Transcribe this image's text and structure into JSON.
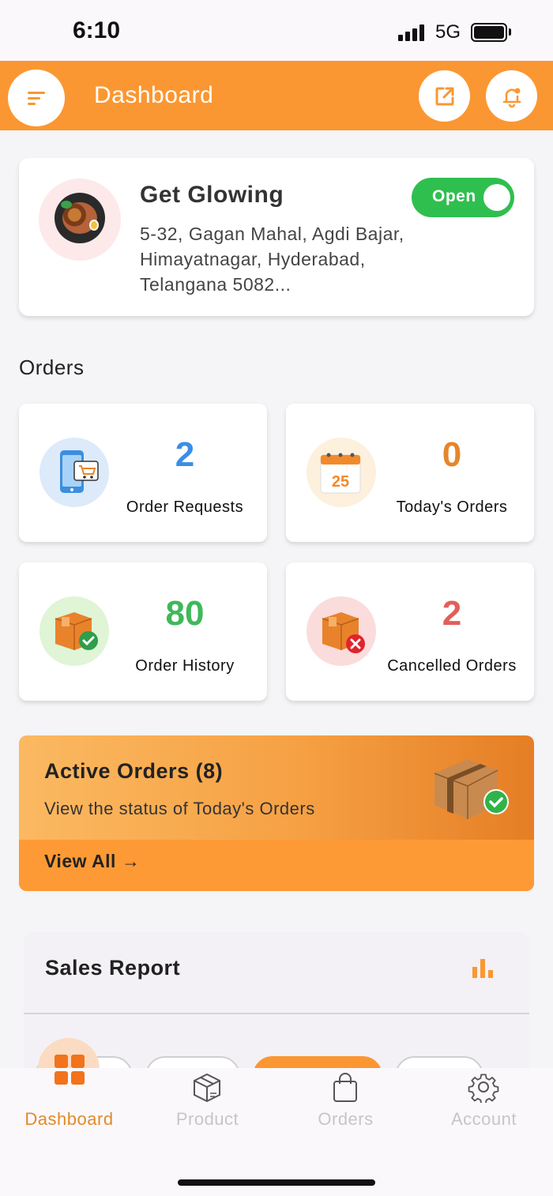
{
  "status_bar": {
    "time": "6:10",
    "network": "5G"
  },
  "header": {
    "title": "Dashboard"
  },
  "store": {
    "name": "Get Glowing",
    "address": "5-32, Gagan Mahal, Agdi Bajar, Himayatnagar, Hyderabad, Telangana 5082...",
    "status_label": "Open"
  },
  "orders": {
    "section_title": "Orders",
    "cards": [
      {
        "count": "2",
        "label": "Order Requests",
        "color": "#3a8ee6"
      },
      {
        "count": "0",
        "label": "Today's Orders",
        "color": "#e5862a"
      },
      {
        "count": "80",
        "label": "Order History",
        "color": "#3fb85a"
      },
      {
        "count": "2",
        "label": "Cancelled Orders",
        "color": "#e0605a"
      }
    ]
  },
  "active_orders": {
    "title": "Active Orders (8)",
    "subtitle": "View the status of Today's Orders",
    "link": "View All →"
  },
  "sales_report": {
    "title": "Sales Report"
  },
  "calendar_day": "25",
  "tabs": [
    {
      "label": "Dashboard",
      "active": true
    },
    {
      "label": "Product",
      "active": false
    },
    {
      "label": "Orders",
      "active": false
    },
    {
      "label": "Account",
      "active": false
    }
  ],
  "colors": {
    "brand": "#fb9732",
    "open_green": "#2fbf4f"
  }
}
